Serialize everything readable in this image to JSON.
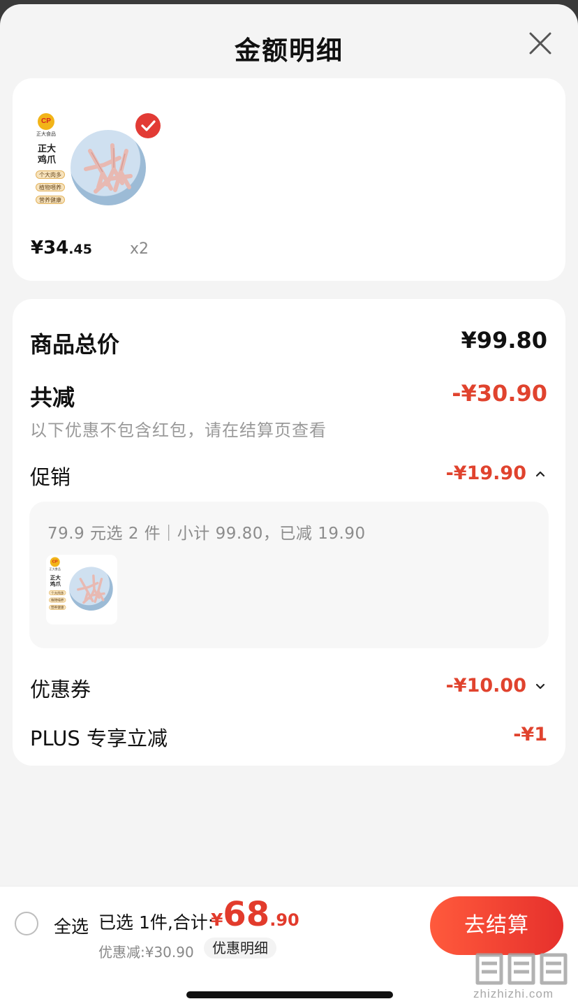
{
  "sheet": {
    "title": "金额明细",
    "close_icon": "close-icon"
  },
  "product": {
    "brand_mark": "CP",
    "brand_name": "正大食品",
    "name": "正大鸡爪",
    "tags": [
      "个大肉多",
      "植物喂养",
      "营养健康"
    ],
    "selected": true,
    "price_symbol": "¥",
    "price_integer": "34",
    "price_decimal": ".45",
    "quantity": "x2"
  },
  "summary": {
    "total_label": "商品总价",
    "total_value": "¥99.80",
    "discount_label": "共减",
    "discount_value": "-¥30.90",
    "discount_note": "以下优惠不包含红包，请在结算页查看",
    "promo_label": "促销",
    "promo_value": "-¥19.90",
    "promo_description": "79.9 元选 2 件｜小计 99.80，已减 19.90",
    "coupon_label": "优惠券",
    "coupon_value": "-¥10.00",
    "plus_label": "PLUS 专享立减",
    "plus_value": "-¥1"
  },
  "bottom_bar": {
    "select_all_label": "全选",
    "selected_text": "已选 1件,合计:",
    "total_symbol": "¥",
    "total_integer": "68",
    "total_decimal": ".90",
    "saved_text": "优惠减:¥30.90",
    "detail_chip": "优惠明细",
    "checkout_label": "去结算"
  },
  "watermark": {
    "text": "zhizhizhi.com"
  },
  "colors": {
    "accent_red": "#e0432e",
    "checkout_gradient_start": "#ff5a3c",
    "checkout_gradient_end": "#e6302c",
    "background": "#f4f4f4"
  }
}
